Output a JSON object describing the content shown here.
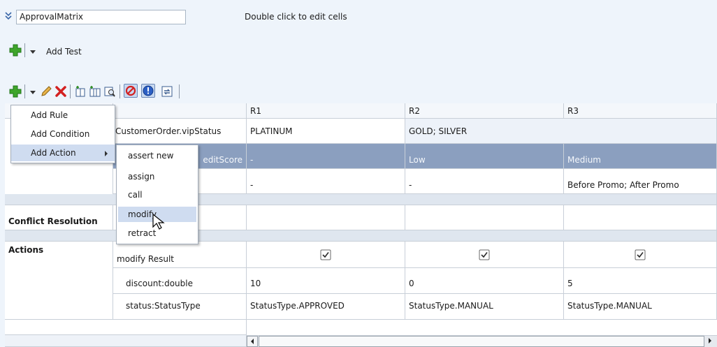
{
  "header": {
    "collapse_icon": "double-chevron-down-icon",
    "name_value": "ApprovalMatrix",
    "hint": "Double click to edit cells"
  },
  "add_test": {
    "label": "Add Test"
  },
  "toolbar": {
    "icons": [
      "add-icon",
      "dropdown-icon",
      "edit-icon",
      "delete-icon",
      "add-column-icon",
      "add-columns-icon",
      "find-icon",
      "disable-icon",
      "conflict-icon",
      "refresh-icon"
    ]
  },
  "table": {
    "columns": [
      "",
      "",
      "R1",
      "R2",
      "R3"
    ],
    "condition_rows": [
      {
        "attr": "CustomerOrder.vipStatus",
        "values": [
          "PLATINUM",
          "GOLD; SILVER",
          ""
        ]
      },
      {
        "attr": "editScore",
        "values": [
          "-",
          "Low",
          "Medium"
        ]
      },
      {
        "attr": "",
        "values": [
          "-",
          "-",
          "Before Promo; After Promo"
        ]
      }
    ],
    "conflict_label": "Conflict Resolution",
    "actions_label": "Actions",
    "action_rows": [
      {
        "attr": "modify Result",
        "values": [
          "checked",
          "checked",
          "checked"
        ]
      },
      {
        "attr": "discount:double",
        "values": [
          "10",
          "0",
          "5"
        ]
      },
      {
        "attr": "status:StatusType",
        "values": [
          "StatusType.APPROVED",
          "StatusType.MANUAL",
          "StatusType.MANUAL"
        ]
      }
    ]
  },
  "menu": {
    "items": [
      "Add Rule",
      "Add Condition",
      "Add Action"
    ],
    "submenu": [
      "assert new",
      "assign",
      "call",
      "modify",
      "retract"
    ]
  }
}
